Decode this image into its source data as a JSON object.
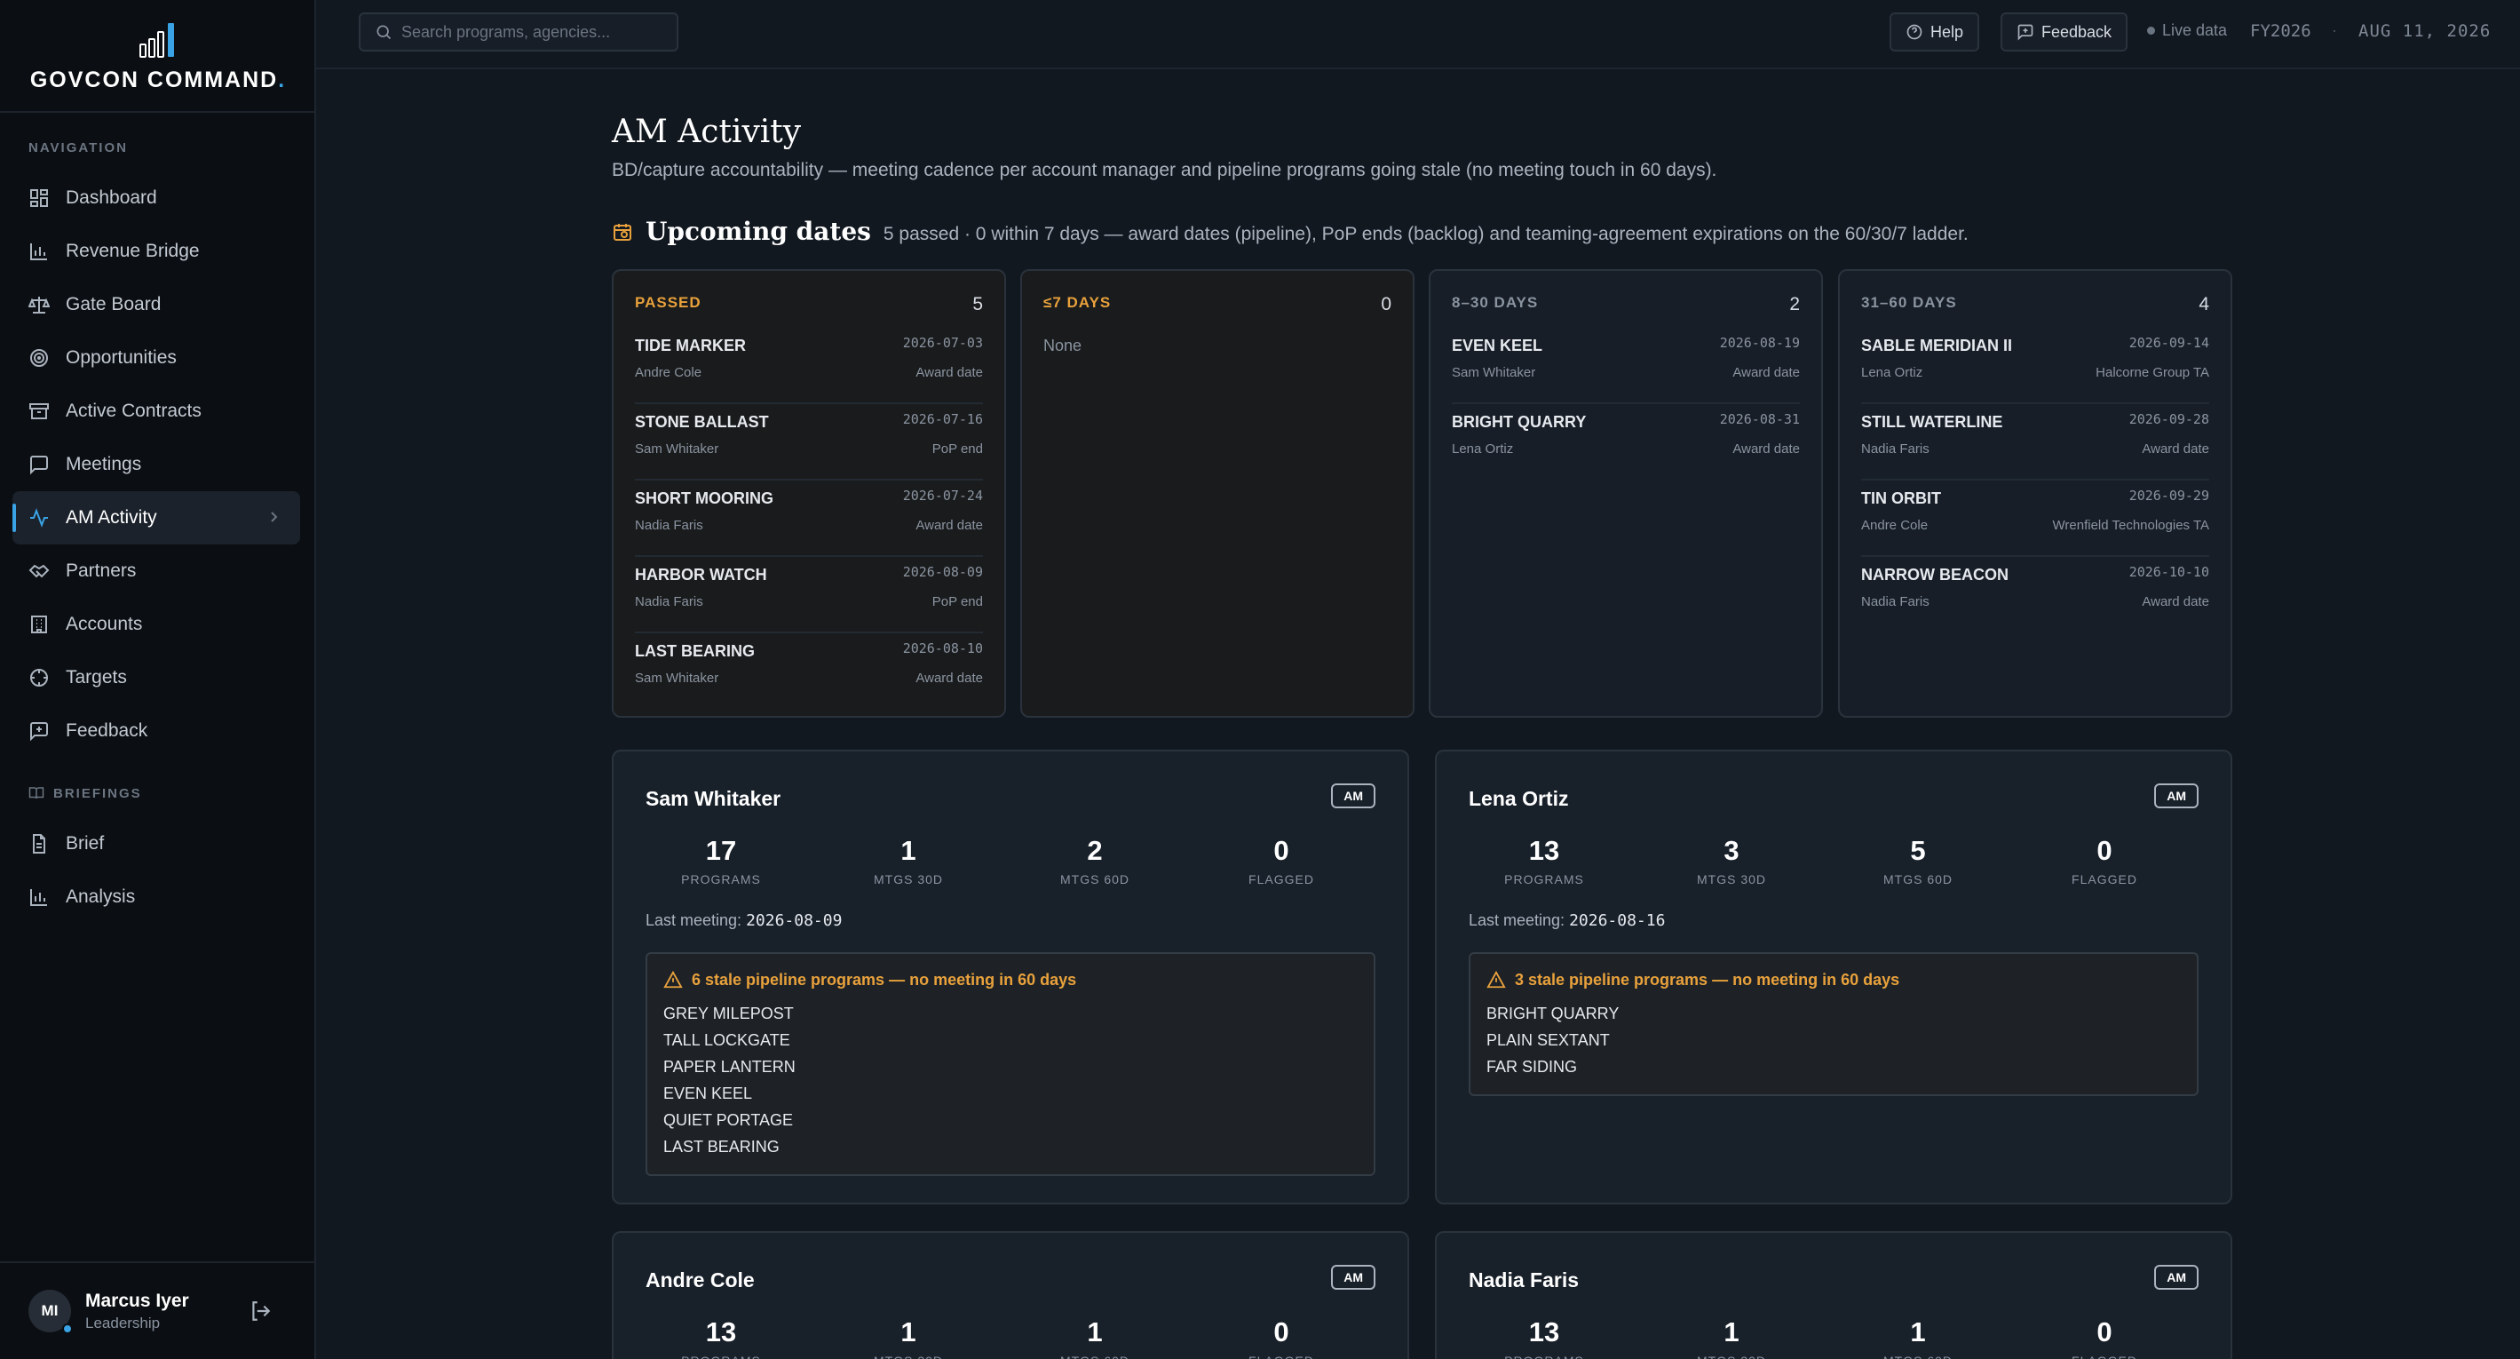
{
  "app": {
    "brand": "GOVCON COMMAND",
    "brand_dot": "."
  },
  "sidebar": {
    "nav_label": "NAVIGATION",
    "briefings_label": "BRIEFINGS",
    "items": [
      {
        "label": "Dashboard",
        "icon": "dashboard-icon"
      },
      {
        "label": "Revenue Bridge",
        "icon": "bar-chart-icon"
      },
      {
        "label": "Gate Board",
        "icon": "scale-icon"
      },
      {
        "label": "Opportunities",
        "icon": "target-icon"
      },
      {
        "label": "Active Contracts",
        "icon": "archive-icon"
      },
      {
        "label": "Meetings",
        "icon": "chat-icon"
      },
      {
        "label": "AM Activity",
        "icon": "activity-icon",
        "active": true
      },
      {
        "label": "Partners",
        "icon": "handshake-icon"
      },
      {
        "label": "Accounts",
        "icon": "building-icon"
      },
      {
        "label": "Targets",
        "icon": "crosshair-icon"
      },
      {
        "label": "Feedback",
        "icon": "feedback-icon"
      }
    ],
    "briefing_items": [
      {
        "label": "Brief",
        "icon": "document-icon"
      },
      {
        "label": "Analysis",
        "icon": "bar-chart-icon"
      }
    ],
    "user": {
      "initials": "MI",
      "name": "Marcus Iyer",
      "role": "Leadership"
    }
  },
  "topbar": {
    "search_placeholder": "Search programs, agencies...",
    "help_label": "Help",
    "feedback_label": "Feedback",
    "live_label": "Live data",
    "fiscal_year": "FY2026",
    "separator": "·",
    "date": "AUG 11, 2026"
  },
  "page": {
    "title": "AM Activity",
    "subtitle": "BD/capture accountability — meeting cadence per account manager and pipeline programs going stale (no meeting touch in 60 days).",
    "upcoming_title": "Upcoming dates",
    "upcoming_sub": "5 passed · 0 within 7 days — award dates (pipeline), PoP ends (backlog) and teaming-agreement expirations on the 60/30/7 ladder."
  },
  "date_columns": [
    {
      "label": "PASSED",
      "count": "5",
      "tone": "warn",
      "rows": [
        {
          "name": "TIDE MARKER",
          "date": "2026-07-03",
          "am": "Andre Cole",
          "kind": "Award date"
        },
        {
          "name": "STONE BALLAST",
          "date": "2026-07-16",
          "am": "Sam Whitaker",
          "kind": "PoP end"
        },
        {
          "name": "SHORT MOORING",
          "date": "2026-07-24",
          "am": "Nadia Faris",
          "kind": "Award date"
        },
        {
          "name": "HARBOR WATCH",
          "date": "2026-08-09",
          "am": "Nadia Faris",
          "kind": "PoP end"
        },
        {
          "name": "LAST BEARING",
          "date": "2026-08-10",
          "am": "Sam Whitaker",
          "kind": "Award date"
        }
      ]
    },
    {
      "label": "≤7 DAYS",
      "count": "0",
      "tone": "warn",
      "empty_text": "None",
      "rows": []
    },
    {
      "label": "8–30 DAYS",
      "count": "2",
      "tone": "neutral",
      "rows": [
        {
          "name": "EVEN KEEL",
          "date": "2026-08-19",
          "am": "Sam Whitaker",
          "kind": "Award date"
        },
        {
          "name": "BRIGHT QUARRY",
          "date": "2026-08-31",
          "am": "Lena Ortiz",
          "kind": "Award date"
        }
      ]
    },
    {
      "label": "31–60 DAYS",
      "count": "4",
      "tone": "neutral",
      "rows": [
        {
          "name": "SABLE MERIDIAN II",
          "date": "2026-09-14",
          "am": "Lena Ortiz",
          "kind": "Halcorne Group TA"
        },
        {
          "name": "STILL WATERLINE",
          "date": "2026-09-28",
          "am": "Nadia Faris",
          "kind": "Award date"
        },
        {
          "name": "TIN ORBIT",
          "date": "2026-09-29",
          "am": "Andre Cole",
          "kind": "Wrenfield Technologies TA"
        },
        {
          "name": "NARROW BEACON",
          "date": "2026-10-10",
          "am": "Nadia Faris",
          "kind": "Award date"
        }
      ]
    }
  ],
  "stat_labels": [
    "PROGRAMS",
    "MTGS 30D",
    "MTGS 60D",
    "FLAGGED"
  ],
  "last_meeting_label": "Last meeting:",
  "am_cards": [
    {
      "name": "Sam Whitaker",
      "badge": "AM",
      "stats": [
        "17",
        "1",
        "2",
        "0"
      ],
      "last_meeting": "2026-08-09",
      "stale_title": "6 stale pipeline programs — no meeting in 60 days",
      "stale": [
        "GREY MILEPOST",
        "TALL LOCKGATE",
        "PAPER LANTERN",
        "EVEN KEEL",
        "QUIET PORTAGE",
        "LAST BEARING"
      ]
    },
    {
      "name": "Lena Ortiz",
      "badge": "AM",
      "stats": [
        "13",
        "3",
        "5",
        "0"
      ],
      "last_meeting": "2026-08-16",
      "stale_title": "3 stale pipeline programs — no meeting in 60 days",
      "stale": [
        "BRIGHT QUARRY",
        "PLAIN SEXTANT",
        "FAR SIDING"
      ]
    },
    {
      "name": "Andre Cole",
      "badge": "AM",
      "stats": [
        "13",
        "1",
        "1",
        "0"
      ]
    },
    {
      "name": "Nadia Faris",
      "badge": "AM",
      "stats": [
        "13",
        "1",
        "1",
        "0"
      ]
    }
  ]
}
